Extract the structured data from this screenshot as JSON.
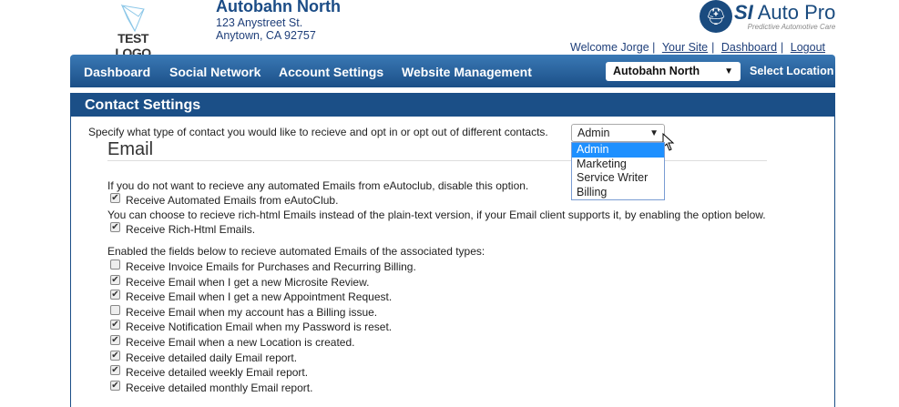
{
  "logo": {
    "text": "TEST LOGO"
  },
  "business": {
    "name": "Autobahn North",
    "address1": "123 Anystreet St.",
    "address2": "Anytown, CA 92757"
  },
  "brand": {
    "name_bold": "SI",
    "name_rest": "Auto Pro",
    "tagline": "Predictive Automotive Care"
  },
  "toplinks": {
    "welcome": "Welcome Jorge",
    "sep": "|",
    "your_site": "Your Site",
    "dashboard": "Dashboard",
    "logout": "Logout"
  },
  "nav": {
    "items": [
      "Dashboard",
      "Social Network",
      "Account Settings",
      "Website Management"
    ],
    "location": "Autobahn North",
    "select_location": "Select Location",
    "arrow": "▼"
  },
  "panel": {
    "title": "Contact Settings",
    "intro": "Specify what type of contact you would like to recieve and opt in or opt out of different contacts.",
    "role_selected": "Admin",
    "role_options": [
      "Admin",
      "Marketing",
      "Service Writer",
      "Billing"
    ]
  },
  "email": {
    "heading": "Email",
    "note1": "If you do not want to recieve any automated Emails from eAutoclub, disable this option.",
    "opt_auto": {
      "label": "Receive Automated Emails from eAutoClub.",
      "checked": true
    },
    "note2": "You can choose to recieve rich-html Emails instead of the plain-text version, if your Email client supports it, by enabling the option below.",
    "opt_rich": {
      "label": "Receive Rich-Html Emails.",
      "checked": true
    },
    "note3": "Enabled the fields below to recieve automated Emails of the associated types:",
    "types": [
      {
        "label": "Receive Invoice Emails for Purchases and Recurring Billing.",
        "checked": false
      },
      {
        "label": "Receive Email when I get a new Microsite Review.",
        "checked": true
      },
      {
        "label": "Receive Email when I get a new Appointment Request.",
        "checked": true
      },
      {
        "label": "Receive Email when my account has a Billing issue.",
        "checked": false
      },
      {
        "label": "Receive Notification Email when my Password is reset.",
        "checked": true
      },
      {
        "label": "Receive Email when a new Location is created.",
        "checked": true
      },
      {
        "label": "Receive detailed daily Email report.",
        "checked": true
      },
      {
        "label": "Receive detailed weekly Email report.",
        "checked": true
      },
      {
        "label": "Receive detailed monthly Email report.",
        "checked": true
      }
    ]
  }
}
